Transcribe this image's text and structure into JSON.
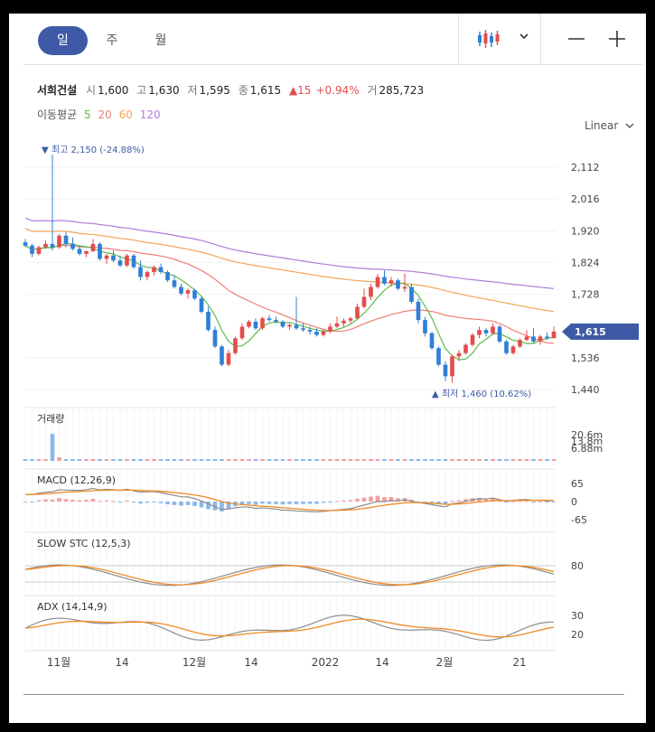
{
  "toolbar": {
    "periods": [
      "일",
      "주",
      "월"
    ],
    "active_period": "일",
    "chart_type_icon": "candlestick-icon",
    "dropdown_icon": "chevron-down-icon",
    "zoom_out_icon": "minus-icon",
    "zoom_in_icon": "plus-icon"
  },
  "stock": {
    "name": "서희건설",
    "open_label": "시",
    "open": "1,600",
    "high_label": "고",
    "high": "1,630",
    "low_label": "저",
    "low": "1,595",
    "close_label": "종",
    "close": "1,615",
    "change": "▲15",
    "change_pct": "+0.94%",
    "volume_label": "거",
    "volume": "285,723"
  },
  "ma_legend": {
    "label": "이동평균",
    "periods": [
      "5",
      "20",
      "60",
      "120"
    ]
  },
  "scale": "Linear",
  "colors": {
    "up": "#e24e4e",
    "down": "#2f7fd8",
    "ma5": "#5dbb4a",
    "ma20": "#ef7f74",
    "ma60": "#f3a65a",
    "ma120": "#b07cd9",
    "accent": "#3e5aa6",
    "macd": "#f08a24",
    "signal": "#8c8c8c"
  },
  "chart_data": {
    "type": "candlestick",
    "price_axis": {
      "ticks": [
        "2,112",
        "2,016",
        "1,920",
        "1,824",
        "1,728",
        "1,536",
        "1,440"
      ],
      "ylim": [
        1440,
        2112
      ],
      "current_price": "1,615"
    },
    "annotations": {
      "high": "최고 2,150 (-24.88%)",
      "low": "최저 1,460 (10.62%)"
    },
    "x_labels": [
      "11월",
      "14",
      "12월",
      "14",
      "2022",
      "14",
      "2월",
      "21"
    ],
    "candles": [
      [
        1885,
        1895,
        1870,
        1875
      ],
      [
        1875,
        1880,
        1840,
        1850
      ],
      [
        1850,
        1875,
        1845,
        1870
      ],
      [
        1870,
        1890,
        1865,
        1880
      ],
      [
        1880,
        2150,
        1860,
        1870
      ],
      [
        1870,
        1910,
        1865,
        1905
      ],
      [
        1905,
        1915,
        1870,
        1880
      ],
      [
        1880,
        1900,
        1860,
        1865
      ],
      [
        1865,
        1875,
        1845,
        1850
      ],
      [
        1850,
        1860,
        1840,
        1858
      ],
      [
        1858,
        1895,
        1855,
        1880
      ],
      [
        1880,
        1885,
        1830,
        1835
      ],
      [
        1835,
        1850,
        1820,
        1845
      ],
      [
        1845,
        1860,
        1825,
        1830
      ],
      [
        1830,
        1845,
        1810,
        1815
      ],
      [
        1815,
        1850,
        1810,
        1845
      ],
      [
        1845,
        1850,
        1805,
        1810
      ],
      [
        1810,
        1830,
        1770,
        1780
      ],
      [
        1780,
        1800,
        1770,
        1795
      ],
      [
        1795,
        1815,
        1785,
        1810
      ],
      [
        1810,
        1820,
        1790,
        1795
      ],
      [
        1795,
        1800,
        1765,
        1770
      ],
      [
        1770,
        1785,
        1745,
        1750
      ],
      [
        1750,
        1760,
        1725,
        1730
      ],
      [
        1730,
        1745,
        1715,
        1740
      ],
      [
        1740,
        1745,
        1710,
        1715
      ],
      [
        1715,
        1720,
        1670,
        1675
      ],
      [
        1675,
        1690,
        1615,
        1620
      ],
      [
        1620,
        1630,
        1565,
        1570
      ],
      [
        1570,
        1575,
        1510,
        1515
      ],
      [
        1515,
        1560,
        1510,
        1550
      ],
      [
        1550,
        1600,
        1545,
        1595
      ],
      [
        1595,
        1640,
        1590,
        1630
      ],
      [
        1630,
        1650,
        1625,
        1645
      ],
      [
        1645,
        1655,
        1620,
        1625
      ],
      [
        1625,
        1660,
        1620,
        1655
      ],
      [
        1655,
        1665,
        1645,
        1650
      ],
      [
        1650,
        1660,
        1640,
        1645
      ],
      [
        1645,
        1650,
        1625,
        1630
      ],
      [
        1630,
        1640,
        1620,
        1635
      ],
      [
        1635,
        1720,
        1620,
        1625
      ],
      [
        1625,
        1640,
        1615,
        1620
      ],
      [
        1620,
        1630,
        1605,
        1615
      ],
      [
        1615,
        1625,
        1600,
        1605
      ],
      [
        1605,
        1620,
        1600,
        1615
      ],
      [
        1615,
        1640,
        1610,
        1630
      ],
      [
        1630,
        1660,
        1625,
        1640
      ],
      [
        1640,
        1655,
        1630,
        1648
      ],
      [
        1648,
        1660,
        1640,
        1655
      ],
      [
        1655,
        1700,
        1650,
        1690
      ],
      [
        1690,
        1745,
        1685,
        1720
      ],
      [
        1720,
        1760,
        1710,
        1750
      ],
      [
        1750,
        1790,
        1745,
        1780
      ],
      [
        1780,
        1800,
        1755,
        1760
      ],
      [
        1760,
        1780,
        1750,
        1770
      ],
      [
        1770,
        1775,
        1740,
        1745
      ],
      [
        1745,
        1790,
        1735,
        1750
      ],
      [
        1750,
        1760,
        1700,
        1705
      ],
      [
        1705,
        1715,
        1640,
        1650
      ],
      [
        1650,
        1660,
        1600,
        1610
      ],
      [
        1610,
        1615,
        1560,
        1565
      ],
      [
        1565,
        1570,
        1510,
        1515
      ],
      [
        1515,
        1525,
        1465,
        1480
      ],
      [
        1480,
        1545,
        1460,
        1540
      ],
      [
        1540,
        1560,
        1525,
        1550
      ],
      [
        1550,
        1580,
        1545,
        1575
      ],
      [
        1575,
        1610,
        1570,
        1605
      ],
      [
        1605,
        1630,
        1595,
        1620
      ],
      [
        1620,
        1625,
        1600,
        1610
      ],
      [
        1610,
        1640,
        1605,
        1630
      ],
      [
        1630,
        1635,
        1580,
        1585
      ],
      [
        1585,
        1590,
        1545,
        1550
      ],
      [
        1550,
        1575,
        1545,
        1570
      ],
      [
        1570,
        1595,
        1565,
        1590
      ],
      [
        1590,
        1620,
        1585,
        1600
      ],
      [
        1600,
        1625,
        1580,
        1585
      ],
      [
        1585,
        1605,
        1575,
        1600
      ],
      [
        1600,
        1612,
        1590,
        1595
      ],
      [
        1595,
        1630,
        1595,
        1615
      ]
    ],
    "indicators": [
      {
        "title": "거래량",
        "ticks": [
          "20.6m",
          "13.8m",
          "6.88m"
        ]
      },
      {
        "title": "MACD (12,26,9)",
        "ticks": [
          "65",
          "0",
          "-65"
        ]
      },
      {
        "title": "SLOW STC (12,5,3)",
        "ticks": [
          "80"
        ]
      },
      {
        "title": "ADX (14,14,9)",
        "ticks": [
          "30",
          "20"
        ]
      }
    ]
  }
}
